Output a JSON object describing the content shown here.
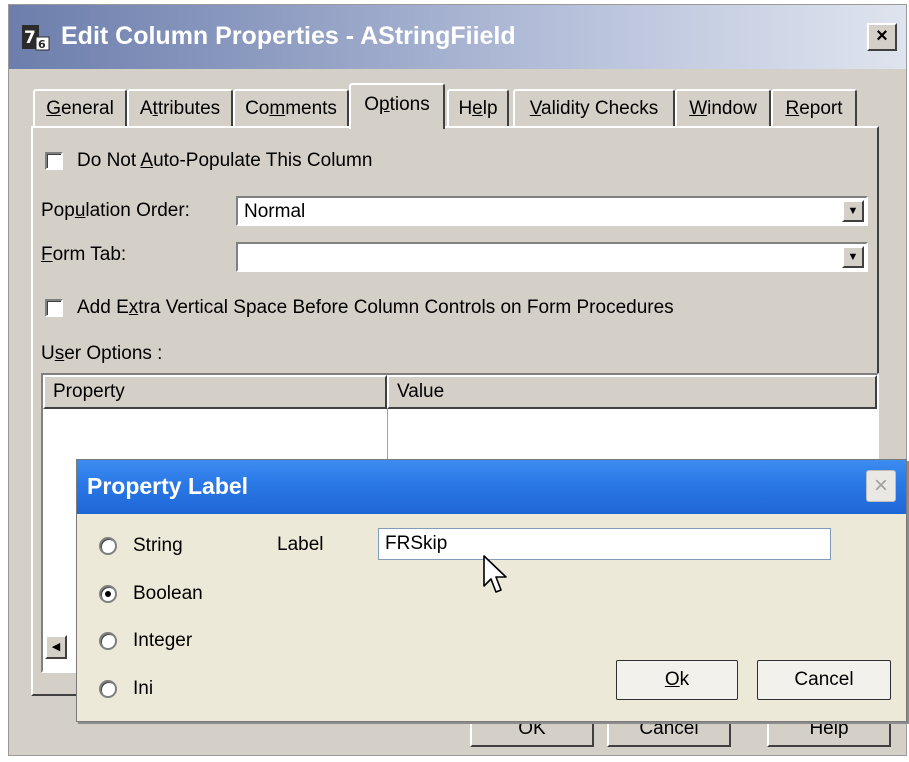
{
  "window": {
    "title": "Edit Column Properties - AStringFiield",
    "close_label": "×"
  },
  "tabs": [
    {
      "label": "General",
      "accel": "G",
      "rest": "eneral"
    },
    {
      "label": "Attributes",
      "pre": "A",
      "accel": "t",
      "rest": "tributes"
    },
    {
      "label": "Comments",
      "pre": "Co",
      "accel": "m",
      "rest": "ments"
    },
    {
      "label": "Options",
      "pre": "O",
      "accel": "p",
      "rest": "tions",
      "active": true
    },
    {
      "label": "Help",
      "pre": "H",
      "accel": "e",
      "rest": "lp"
    },
    {
      "label": "Validity Checks",
      "accel": "V",
      "rest": "alidity Checks"
    },
    {
      "label": "Window",
      "accel": "W",
      "rest": "indow"
    },
    {
      "label": "Report",
      "accel": "R",
      "rest": "eport"
    }
  ],
  "options": {
    "no_autopopulate": {
      "pre": "Do Not ",
      "accel": "A",
      "rest": "uto-Populate This Column",
      "checked": false
    },
    "population_order": {
      "pre": "Pop",
      "accel": "u",
      "rest": "lation Order:",
      "value": "Normal"
    },
    "form_tab": {
      "pre": "",
      "accel": "F",
      "rest": "orm Tab:",
      "value": ""
    },
    "extra_space": {
      "pre": "Add E",
      "accel": "x",
      "rest": "tra Vertical Space Before Column Controls on Form Procedures",
      "checked": false
    },
    "user_options": {
      "pre": "U",
      "accel": "s",
      "rest": "er Options :"
    },
    "grid": {
      "columns": [
        "Property",
        "Value"
      ]
    }
  },
  "main_buttons": [
    {
      "label": "OK"
    },
    {
      "label": "Cancel"
    },
    {
      "label": "Help"
    }
  ],
  "property_dialog": {
    "title": "Property Label",
    "close_label": "×",
    "types": [
      {
        "label": "String",
        "checked": false
      },
      {
        "label": "Boolean",
        "checked": true
      },
      {
        "label": "Integer",
        "checked": false
      },
      {
        "label": "Ini",
        "checked": false
      }
    ],
    "label_caption": "Label",
    "label_value": "FRSkip",
    "ok": {
      "accel": "O",
      "rest": "k"
    },
    "cancel": "Cancel"
  },
  "colors": {
    "main_title_gradient_start": "#6d7eac",
    "prop_title_blue": "#2a78e6",
    "face": "#d4d0c8"
  }
}
